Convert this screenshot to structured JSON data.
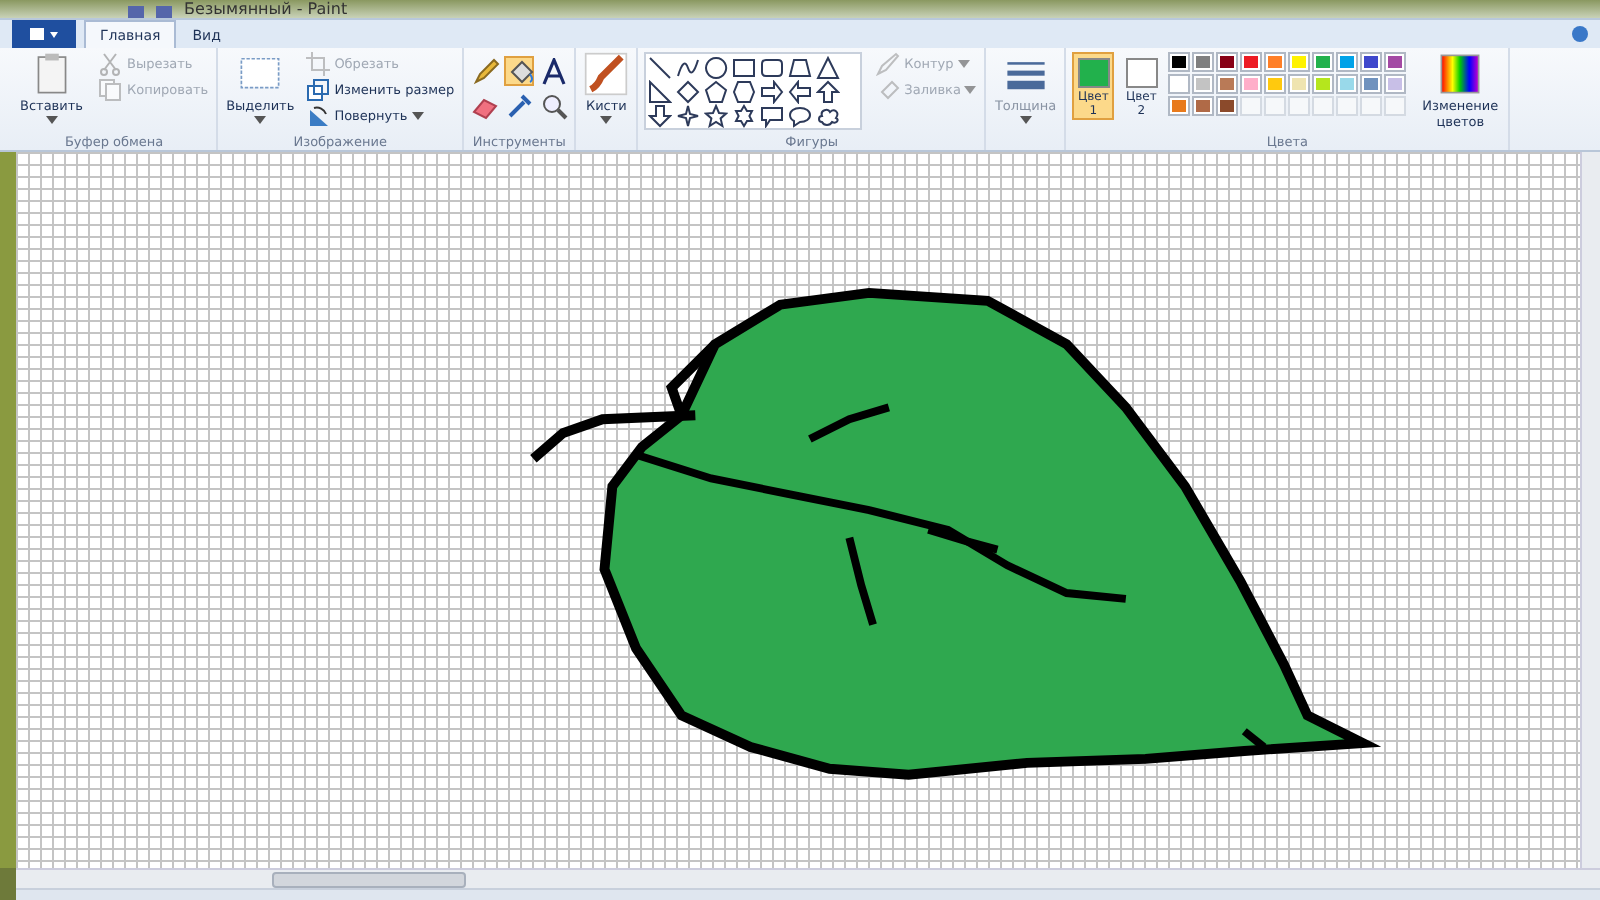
{
  "window": {
    "title": "Безымянный - Paint"
  },
  "tabs": [
    {
      "label": "Главная",
      "selected": true
    },
    {
      "label": "Вид",
      "selected": false
    }
  ],
  "clipboard": {
    "paste": "Вставить",
    "cut": {
      "label": "Вырезать",
      "disabled": true
    },
    "copy": {
      "label": "Копировать",
      "disabled": true
    },
    "group_label": "Буфер обмена"
  },
  "image": {
    "select": "Выделить",
    "crop": {
      "label": "Обрезать",
      "disabled": true
    },
    "resize": {
      "label": "Изменить размер",
      "disabled": false
    },
    "rotate": {
      "label": "Повернуть",
      "disabled": false
    },
    "group_label": "Изображение"
  },
  "tools": {
    "items": [
      {
        "kind": "pencil",
        "selected": false
      },
      {
        "kind": "fill",
        "selected": true
      },
      {
        "kind": "text",
        "selected": false
      },
      {
        "kind": "eraser",
        "selected": false
      },
      {
        "kind": "picker",
        "selected": false
      },
      {
        "kind": "magnifier",
        "selected": false
      }
    ],
    "group_label": "Инструменты"
  },
  "brushes": {
    "label": "Кисти"
  },
  "shapes": {
    "outline": {
      "label": "Контур",
      "disabled": true
    },
    "fill": {
      "label": "Заливка",
      "disabled": true
    },
    "group_label": "Фигуры"
  },
  "size": {
    "label": "Толщина",
    "disabled": true
  },
  "colors": {
    "color1": {
      "label": "Цвет",
      "number": "1",
      "color": "#22b14c",
      "selected": true
    },
    "color2": {
      "label": "Цвет",
      "number": "2",
      "color": "#ffffff",
      "selected": false
    },
    "palette": [
      {
        "kind": "color",
        "color": "#000000"
      },
      {
        "kind": "color",
        "color": "#7f7f7f"
      },
      {
        "kind": "color",
        "color": "#880015"
      },
      {
        "kind": "color",
        "color": "#ed1c24"
      },
      {
        "kind": "color",
        "color": "#ff7f27"
      },
      {
        "kind": "color",
        "color": "#fff200"
      },
      {
        "kind": "color",
        "color": "#22b14c"
      },
      {
        "kind": "color",
        "color": "#00a2e8"
      },
      {
        "kind": "color",
        "color": "#3f48cc"
      },
      {
        "kind": "color",
        "color": "#a349a4"
      },
      {
        "kind": "color",
        "color": "#ffffff"
      },
      {
        "kind": "color",
        "color": "#c3c3c3"
      },
      {
        "kind": "color",
        "color": "#b97a57"
      },
      {
        "kind": "color",
        "color": "#ffaec9"
      },
      {
        "kind": "color",
        "color": "#ffc90e"
      },
      {
        "kind": "color",
        "color": "#efe4b0"
      },
      {
        "kind": "color",
        "color": "#b5e61d"
      },
      {
        "kind": "color",
        "color": "#99d9ea"
      },
      {
        "kind": "color",
        "color": "#7092be"
      },
      {
        "kind": "color",
        "color": "#c8bfe7"
      },
      {
        "kind": "color",
        "color": "#e87a1c"
      },
      {
        "kind": "color",
        "color": "#b06a47"
      },
      {
        "kind": "color",
        "color": "#8b4a2b"
      },
      {
        "kind": "empty"
      },
      {
        "kind": "empty"
      },
      {
        "kind": "empty"
      },
      {
        "kind": "empty"
      },
      {
        "kind": "empty"
      },
      {
        "kind": "empty"
      },
      {
        "kind": "empty"
      }
    ],
    "edit": "Изменение цветов",
    "group_label": "Цвета"
  }
}
